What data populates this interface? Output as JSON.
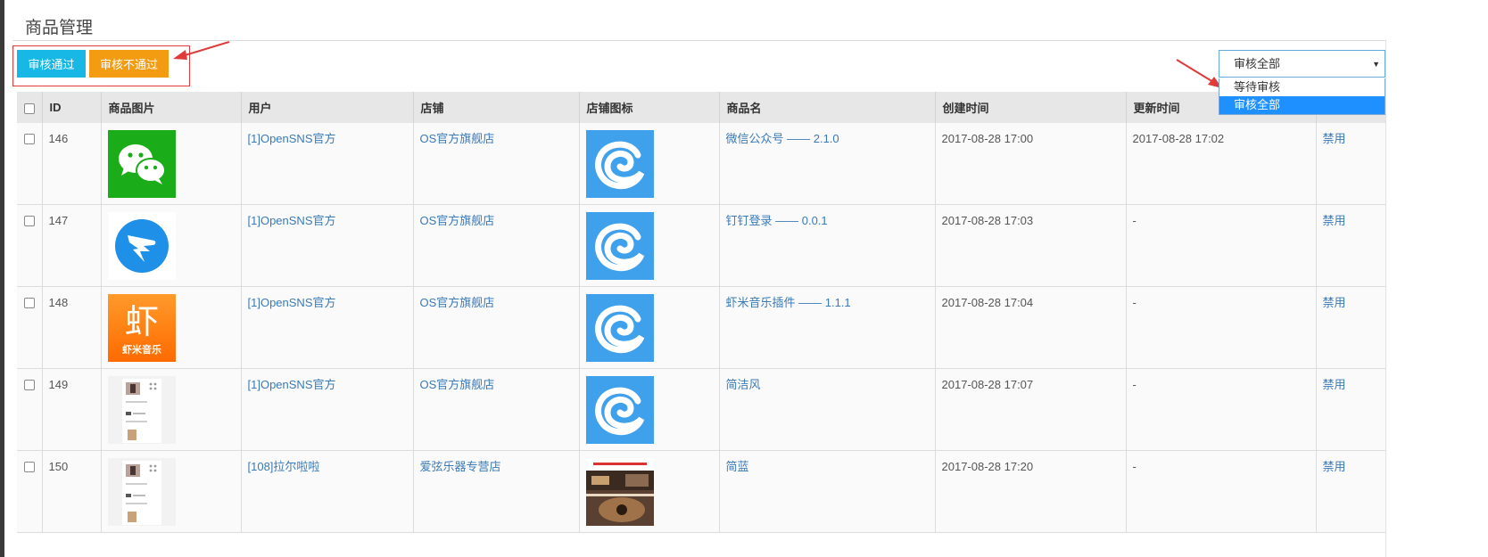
{
  "page": {
    "title": "商品管理"
  },
  "toolbar": {
    "approve_label": "审核通过",
    "reject_label": "审核不通过"
  },
  "filter": {
    "selected": "审核全部",
    "options": [
      "等待审核",
      "审核全部"
    ],
    "highlighted_option": "审核全部"
  },
  "table": {
    "headers": [
      "ID",
      "商品图片",
      "用户",
      "店铺",
      "店铺图标",
      "商品名",
      "创建时间",
      "更新时间",
      ""
    ],
    "rows": [
      {
        "id": "146",
        "image": "wechat-icon",
        "user": "[1]OpenSNS官方",
        "shop": "OS官方旗舰店",
        "shop_icon": "opensns-logo",
        "name": "微信公众号 —— 2.1.0",
        "created": "2017-08-28 17:00",
        "updated": "2017-08-28 17:02",
        "action": "禁用"
      },
      {
        "id": "147",
        "image": "dingtalk-icon",
        "user": "[1]OpenSNS官方",
        "shop": "OS官方旗舰店",
        "shop_icon": "opensns-logo",
        "name": "钉钉登录 —— 0.0.1",
        "created": "2017-08-28 17:03",
        "updated": "-",
        "action": "禁用"
      },
      {
        "id": "148",
        "image": "xiami-music-icon",
        "image_caption": "虾米音乐",
        "image_glyph": "虾",
        "user": "[1]OpenSNS官方",
        "shop": "OS官方旗舰店",
        "shop_icon": "opensns-logo",
        "name": "虾米音乐插件 —— 1.1.1",
        "created": "2017-08-28 17:04",
        "updated": "-",
        "action": "禁用"
      },
      {
        "id": "149",
        "image": "theme-preview-thumbnail",
        "user": "[1]OpenSNS官方",
        "shop": "OS官方旗舰店",
        "shop_icon": "opensns-logo",
        "name": "简洁风",
        "created": "2017-08-28 17:07",
        "updated": "-",
        "action": "禁用"
      },
      {
        "id": "150",
        "image": "theme-preview-thumbnail",
        "user": "[108]拉尔啦啦",
        "shop": "爱弦乐器专营店",
        "shop_icon": "guitar-shop-photo",
        "name": "简蓝",
        "created": "2017-08-28 17:20",
        "updated": "-",
        "action": "禁用"
      }
    ]
  },
  "colors": {
    "approve_button": "#17b8e6",
    "reject_button": "#f39c12",
    "annotation_red": "#e03a3a",
    "link": "#3a7ab8",
    "dropdown_highlight": "#1e90ff",
    "header_bg": "#e7e7e7"
  }
}
